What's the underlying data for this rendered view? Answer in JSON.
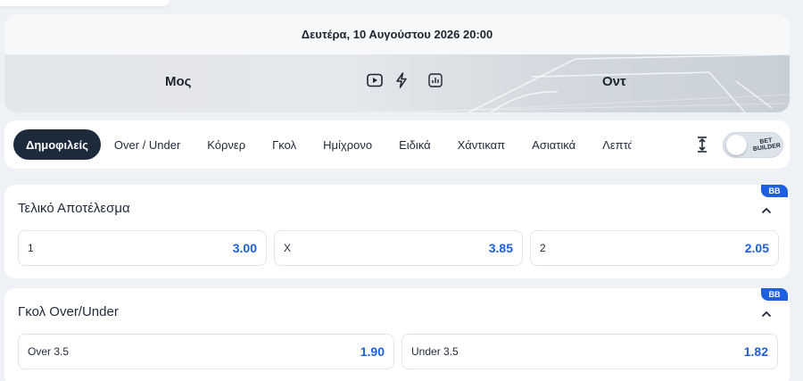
{
  "match": {
    "date": "Δευτέρα, 10 Αυγούστου 2026 20:00",
    "home_team": "Μος",
    "away_team": "Οντ",
    "icons": [
      "play-icon",
      "lightning-icon",
      "stats-icon"
    ]
  },
  "tabs": [
    {
      "label": "Δημοφιλείς",
      "active": true
    },
    {
      "label": "Over / Under",
      "active": false
    },
    {
      "label": "Κόρνερ",
      "active": false
    },
    {
      "label": "Γκολ",
      "active": false
    },
    {
      "label": "Ημίχρονο",
      "active": false
    },
    {
      "label": "Ειδικά",
      "active": false
    },
    {
      "label": "Χάντικαπ",
      "active": false
    },
    {
      "label": "Ασιατικά",
      "active": false
    },
    {
      "label": "Λεπτά",
      "active": false
    }
  ],
  "bet_builder": {
    "label_line1": "BET",
    "label_line2": "BUILDER",
    "enabled": false
  },
  "markets": [
    {
      "title": "Τελικό Αποτέλεσμα",
      "badge": "BB",
      "odds": [
        {
          "label": "1",
          "value": "3.00"
        },
        {
          "label": "X",
          "value": "3.85"
        },
        {
          "label": "2",
          "value": "2.05"
        }
      ]
    },
    {
      "title": "Γκολ Over/Under",
      "badge": "BB",
      "odds": [
        {
          "label": "Over 3.5",
          "value": "1.90"
        },
        {
          "label": "Under 3.5",
          "value": "1.82"
        }
      ]
    }
  ],
  "colors": {
    "accent": "#1d5fe0",
    "active_tab": "#1c2a3c",
    "background": "#eef1f5"
  }
}
